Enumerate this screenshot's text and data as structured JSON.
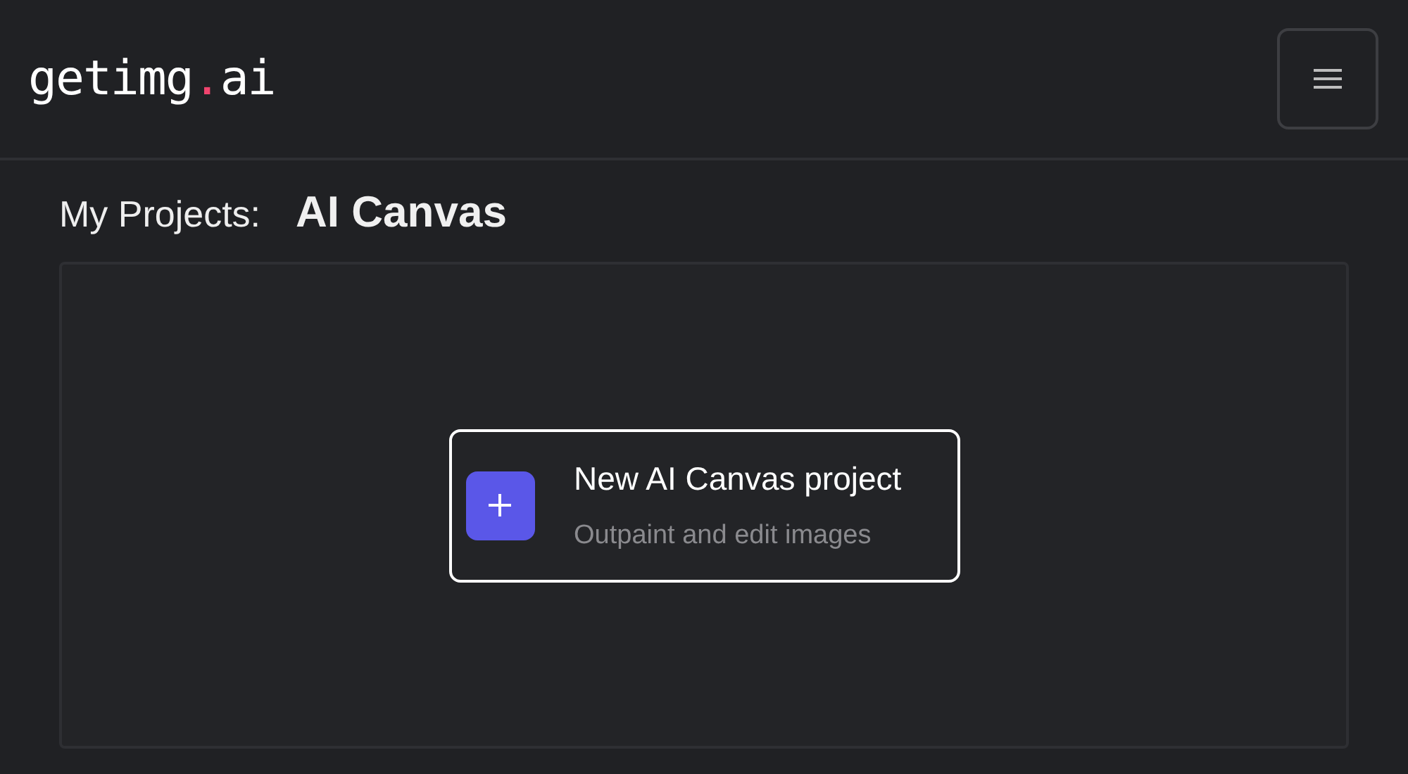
{
  "header": {
    "logo": {
      "name": "getimg",
      "dot": ".",
      "suffix": "ai"
    }
  },
  "page": {
    "label": "My Projects:",
    "title": "AI Canvas"
  },
  "new_project": {
    "title": "New AI Canvas project",
    "subtitle": "Outpaint and edit images"
  }
}
